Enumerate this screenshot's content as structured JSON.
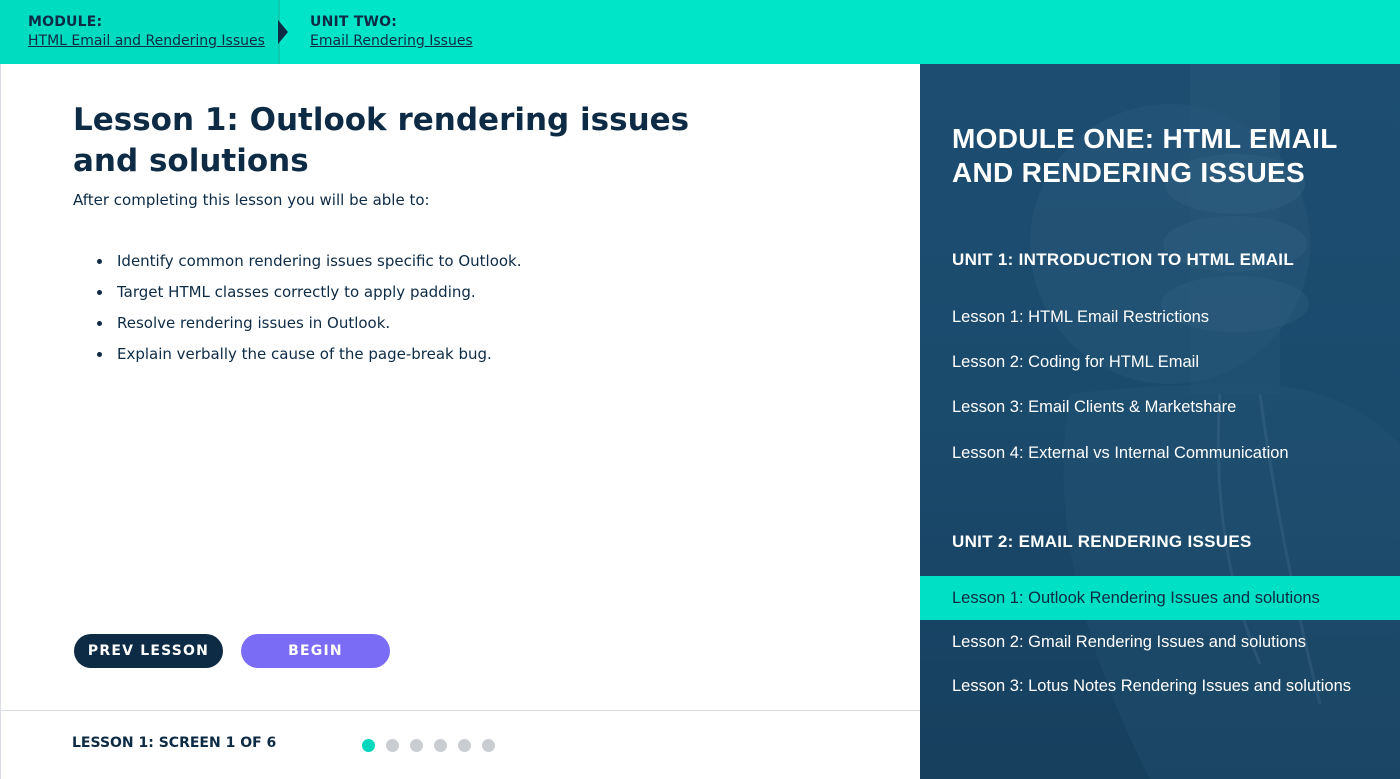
{
  "breadcrumb": {
    "module_label": "MODULE:",
    "module_link": "HTML Email and Rendering Issues",
    "unit_label": "UNIT TWO:",
    "unit_link": "Email Rendering Issues"
  },
  "lesson": {
    "title": "Lesson 1: Outlook rendering issues and solutions",
    "intro": "After completing this lesson you will be able to:",
    "objectives": [
      "Identify common rendering issues specific to Outlook.",
      "Target HTML classes correctly to apply padding.",
      "Resolve rendering issues in Outlook.",
      "Explain verbally the cause of the page-break bug."
    ]
  },
  "buttons": {
    "prev": "PREV LESSON",
    "begin": "BEGIN"
  },
  "footer": {
    "screen_count": "LESSON 1: SCREEN 1 OF 6",
    "current_screen": 1,
    "total_screens": 6
  },
  "sidebar": {
    "module_title": "MODULE ONE: HTML EMAIL AND RENDERING ISSUES",
    "units": [
      {
        "heading": "UNIT 1: INTRODUCTION TO HTML EMAIL",
        "lessons": [
          "Lesson 1: HTML Email Restrictions",
          "Lesson 2: Coding for HTML Email",
          "Lesson 3: Email Clients & Marketshare",
          "Lesson 4: External vs Internal Communication"
        ]
      },
      {
        "heading": "UNIT 2: EMAIL RENDERING ISSUES",
        "lessons": [
          "Lesson 1: Outlook Rendering Issues and solutions",
          "Lesson 2: Gmail Rendering Issues and solutions",
          "Lesson 3: Lotus Notes Rendering Issues and solutions"
        ]
      }
    ],
    "active_lesson": "Lesson 1: Outlook Rendering Issues and solutions"
  },
  "colors": {
    "accent": "#00e5c8",
    "navy": "#0d2b45",
    "purple": "#7b6cf6",
    "sidebar_bg": "#1a4a6c"
  }
}
